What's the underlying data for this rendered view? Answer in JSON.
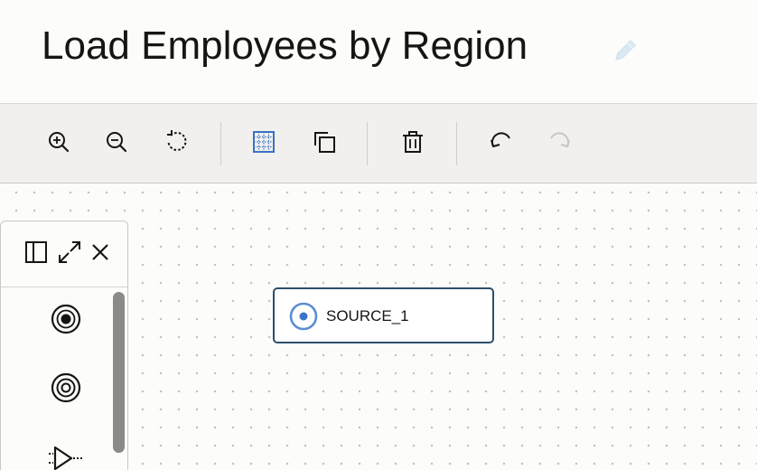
{
  "header": {
    "title": "Load Employees by Region",
    "edit_icon": "pencil-icon"
  },
  "toolbar": {
    "buttons": [
      {
        "name": "zoom-in",
        "icon": "zoom-in-icon"
      },
      {
        "name": "zoom-out",
        "icon": "zoom-out-icon"
      },
      {
        "name": "reset-zoom",
        "icon": "refresh-icon"
      },
      {
        "name": "grid",
        "icon": "grid-icon",
        "active": true
      },
      {
        "name": "duplicate",
        "icon": "copy-icon"
      },
      {
        "name": "delete",
        "icon": "trash-icon"
      },
      {
        "name": "undo",
        "icon": "undo-icon"
      },
      {
        "name": "redo",
        "icon": "redo-icon",
        "disabled": true
      }
    ],
    "accent_color": "#3a73c4"
  },
  "palette": {
    "header_icons": [
      "panel-toggle-icon",
      "expand-icon",
      "close-icon"
    ],
    "items": [
      {
        "icon": "source-operator-icon"
      },
      {
        "icon": "target-operator-icon"
      },
      {
        "icon": "filter-operator-icon"
      }
    ]
  },
  "canvas": {
    "nodes": [
      {
        "label": "SOURCE_1",
        "icon": "source-node-icon",
        "border_color": "#2c4f6b",
        "icon_color": "#5a8fd0"
      }
    ]
  }
}
